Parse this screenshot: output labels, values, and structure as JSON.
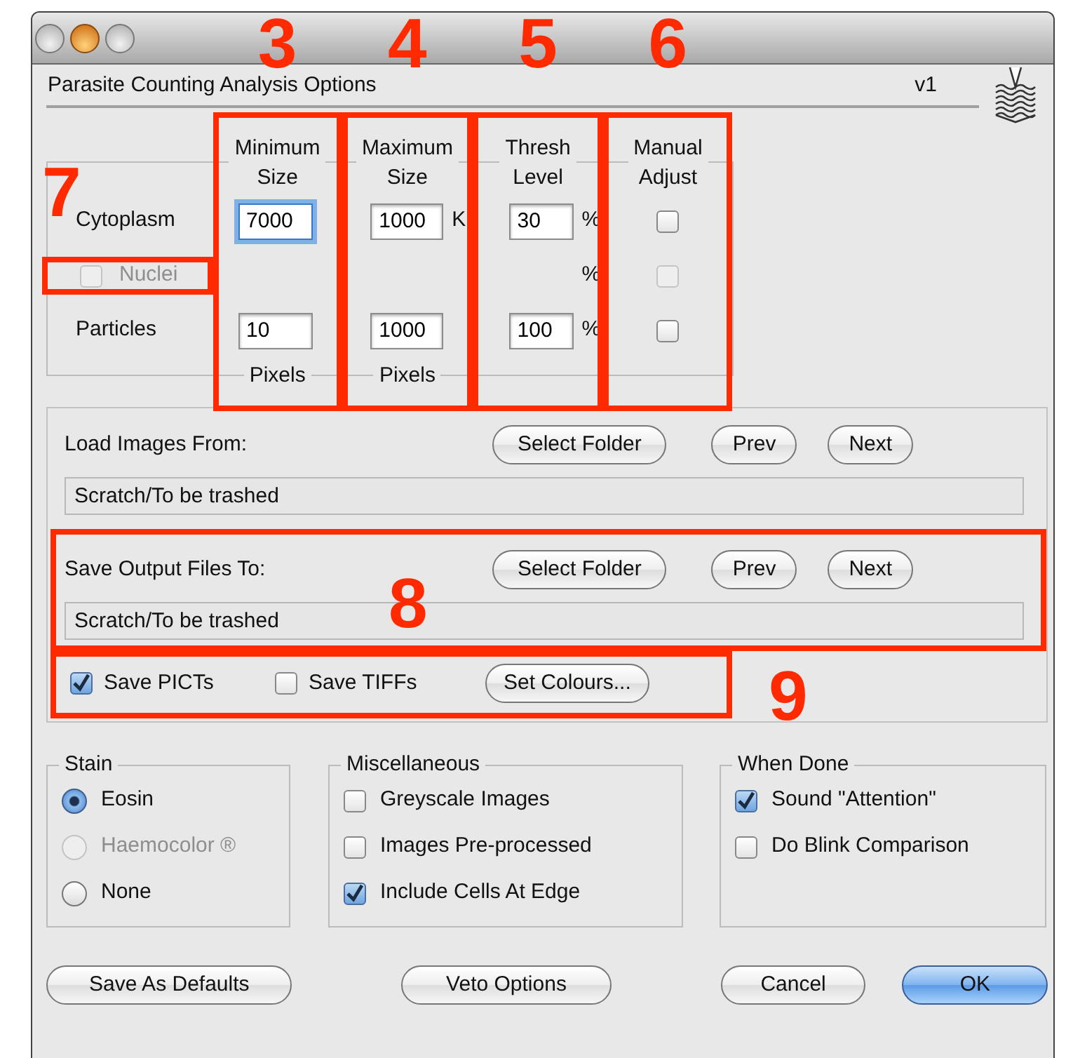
{
  "header": {
    "title": "Parasite Counting Analysis Options",
    "version": "v1"
  },
  "size_panel": {
    "columns": [
      {
        "heading": "Minimum Size",
        "footer": "Pixels",
        "annotation": "3"
      },
      {
        "heading": "Maximum Size",
        "footer": "Pixels",
        "annotation": "4"
      },
      {
        "heading": "Thresh Level",
        "annotation": "5"
      },
      {
        "heading": "Manual Adjust",
        "annotation": "6"
      }
    ],
    "rows": [
      {
        "kind": "label",
        "label": "Cytoplasm",
        "min": {
          "value": "7000",
          "focused": true
        },
        "max": {
          "value": "1000",
          "unit": "K"
        },
        "thresh": {
          "value": "30",
          "unit": "%"
        },
        "manual": {
          "checked": false,
          "disabled": false
        }
      },
      {
        "kind": "checkbox",
        "label": "Nuclei",
        "checked": false,
        "disabled": true,
        "annotation": "7",
        "thresh": {
          "unit": "%"
        },
        "manual": {
          "checked": false,
          "disabled": true
        }
      },
      {
        "kind": "label",
        "label": "Particles",
        "min": {
          "value": "10",
          "focused": false
        },
        "max": {
          "value": "1000"
        },
        "thresh": {
          "value": "100",
          "unit": "%"
        },
        "manual": {
          "checked": false,
          "disabled": false
        }
      }
    ]
  },
  "folders": [
    {
      "label": "Load Images From:",
      "buttons": [
        "Select Folder",
        "Prev",
        "Next"
      ],
      "path": "Scratch/To be trashed"
    },
    {
      "label": "Save Output Files To:",
      "buttons": [
        "Select Folder",
        "Prev",
        "Next"
      ],
      "path": "Scratch/To be trashed",
      "annotation": "8"
    }
  ],
  "output_options": {
    "checkboxes": [
      {
        "label": "Save PICTs",
        "checked": true
      },
      {
        "label": "Save TIFFs",
        "checked": false
      }
    ],
    "button": "Set Colours...",
    "annotation": "9"
  },
  "groups": [
    {
      "title": "Stain",
      "kind": "radio",
      "items": [
        {
          "label": "Eosin",
          "selected": true,
          "disabled": false
        },
        {
          "label": "Haemocolor ®",
          "selected": false,
          "disabled": true
        },
        {
          "label": "None",
          "selected": false,
          "disabled": false
        }
      ]
    },
    {
      "title": "Miscellaneous",
      "kind": "checkbox",
      "items": [
        {
          "label": "Greyscale Images",
          "checked": false
        },
        {
          "label": "Images Pre-processed",
          "checked": false
        },
        {
          "label": "Include Cells At Edge",
          "checked": true
        }
      ]
    },
    {
      "title": "When Done",
      "kind": "checkbox",
      "items": [
        {
          "label": "Sound \"Attention\"",
          "checked": true
        },
        {
          "label": "Do Blink Comparison",
          "checked": false
        }
      ]
    }
  ],
  "buttons": [
    {
      "label": "Save As Defaults",
      "kind": "normal"
    },
    {
      "label": "Veto Options",
      "kind": "normal"
    },
    {
      "label": "Cancel",
      "kind": "normal"
    },
    {
      "label": "OK",
      "kind": "default"
    }
  ]
}
